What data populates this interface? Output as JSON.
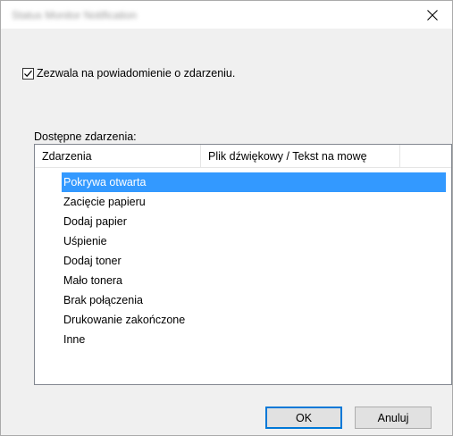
{
  "window": {
    "title": "Status Monitor Notification"
  },
  "options": {
    "enable_label": "Zezwala na powiadomienie o zdarzeniu.",
    "enable_checked": true
  },
  "events": {
    "label": "Dostępne zdarzenia:",
    "columns": [
      "Zdarzenia",
      "Plik dźwiękowy / Tekst na mowę"
    ],
    "rows": [
      "Pokrywa otwarta",
      "Zacięcie papieru",
      "Dodaj papier",
      "Uśpienie",
      "Dodaj toner",
      "Mało tonera",
      "Brak połączenia",
      "Drukowanie zakończone",
      "Inne"
    ],
    "selected_index": 0
  },
  "buttons": {
    "ok_label": "OK",
    "cancel_label": "Anuluj"
  },
  "icons": {
    "close": "close-icon",
    "check": "checkmark-icon"
  },
  "colors": {
    "selection": "#3399ff",
    "default_button_border": "#0078d7"
  }
}
